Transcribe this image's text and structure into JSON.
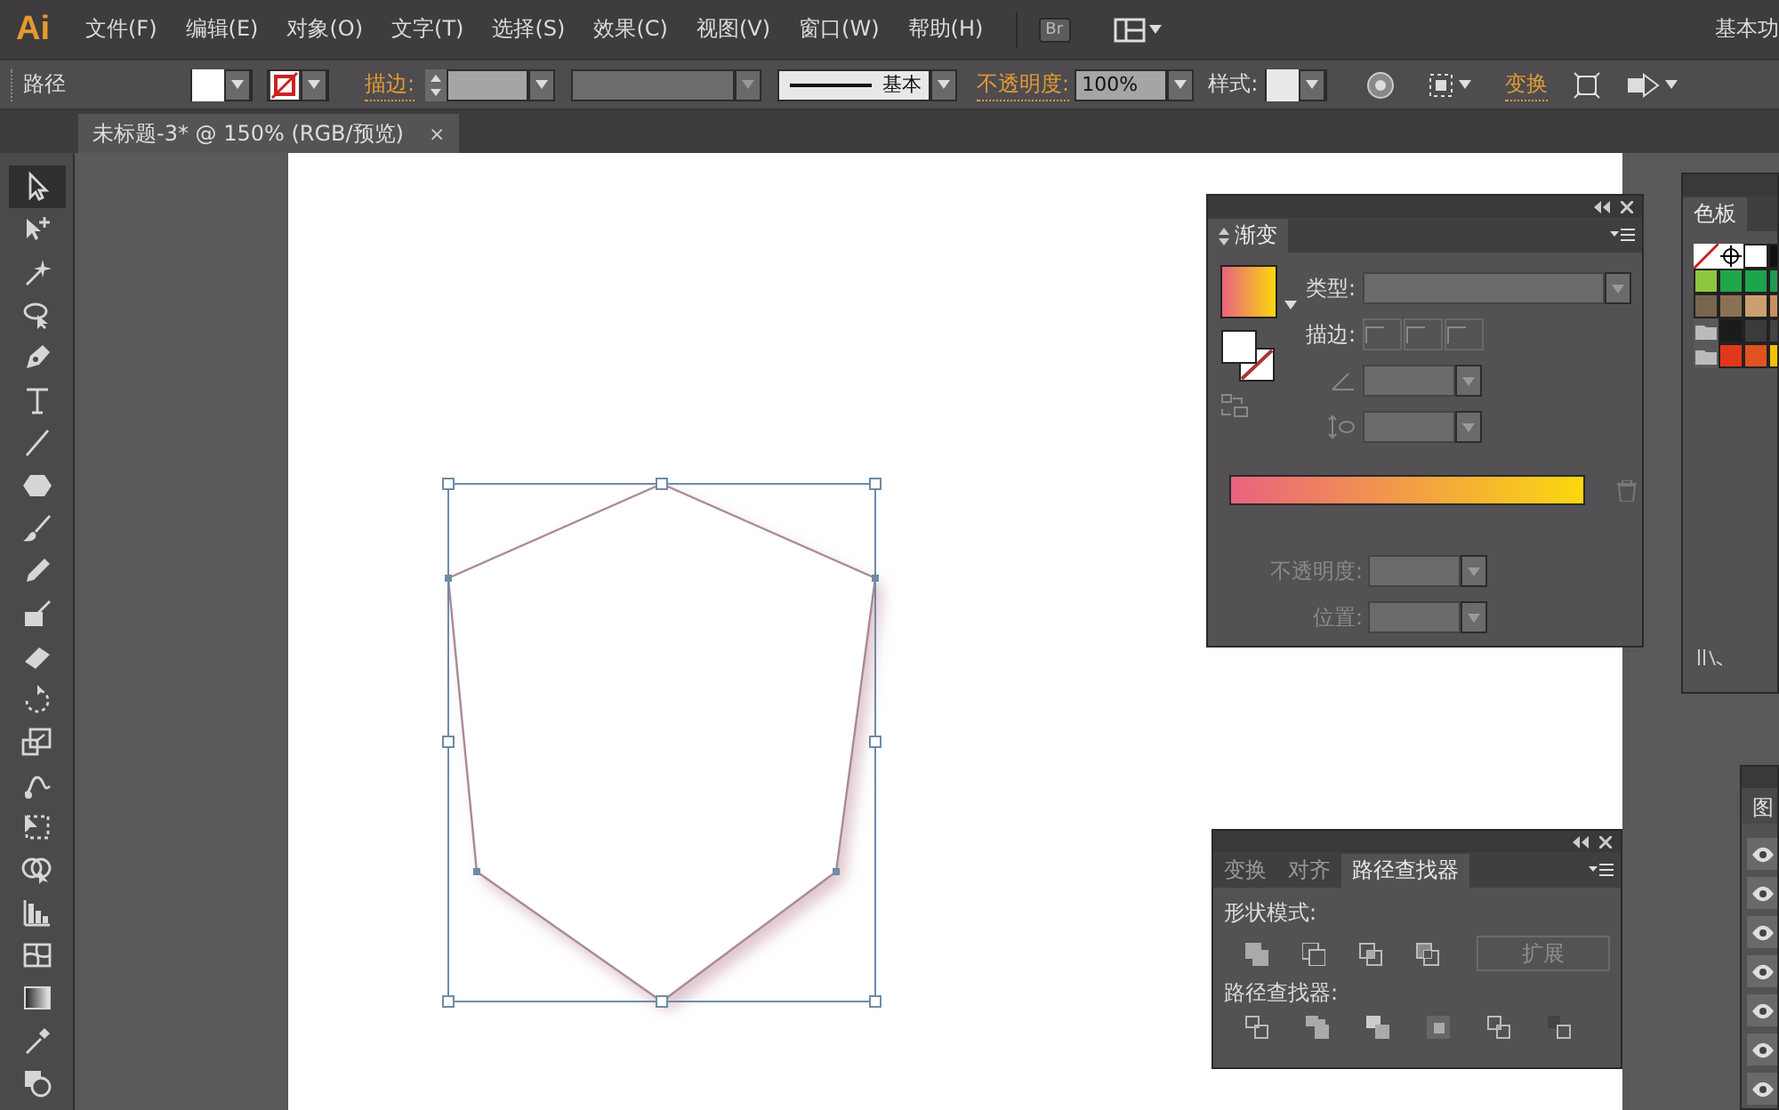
{
  "menu_bar": {
    "logo": "Ai",
    "menus": [
      "文件(F)",
      "编辑(E)",
      "对象(O)",
      "文字(T)",
      "选择(S)",
      "效果(C)",
      "视图(V)",
      "窗口(W)",
      "帮助(H)"
    ],
    "bridge_button": "Br",
    "workspace": "基本功"
  },
  "control_bar": {
    "selection": "路径",
    "stroke_label": "描边:",
    "line_style": "基本",
    "opacity_label": "不透明度:",
    "opacity": "100%",
    "style_label": "样式:",
    "transform_link": "变换"
  },
  "document_tab": {
    "title": "未标题-3* @ 150% (RGB/预览)",
    "close": "×"
  },
  "tools": [
    {
      "selected": true
    },
    {
      "selected": false
    },
    {
      "selected": false
    },
    {
      "selected": false
    },
    {
      "selected": false
    },
    {
      "selected": false
    },
    {
      "selected": false
    },
    {
      "selected": false
    },
    {
      "selected": false
    },
    {
      "selected": false
    },
    {
      "selected": false
    },
    {
      "selected": false
    },
    {
      "selected": false
    },
    {
      "selected": false
    },
    {
      "selected": false
    },
    {
      "selected": false
    },
    {
      "selected": false
    },
    {
      "selected": false
    },
    {
      "selected": false
    },
    {
      "selected": false
    },
    {
      "selected": false
    },
    {
      "selected": false
    }
  ],
  "gradient_panel": {
    "tab": "渐变",
    "type_label": "类型:",
    "stroke_label": "描边:",
    "opacity_label": "不透明度:",
    "location_label": "位置:",
    "stops": [
      {
        "color": "#e9637f"
      },
      {
        "color": "#fbd80f"
      }
    ]
  },
  "swatches_panel": {
    "tab": "色板",
    "swatches": [
      {
        "kind": "none"
      },
      {
        "kind": "registration"
      },
      {
        "kind": "color",
        "color": "#ffffff"
      },
      {
        "kind": "color",
        "color": "#111111"
      },
      {
        "kind": "color",
        "color": "#8dc63f"
      },
      {
        "kind": "color",
        "color": "#1fa84a"
      },
      {
        "kind": "color",
        "color": "#1ca54c"
      },
      {
        "kind": "color",
        "color": "#209a52"
      },
      {
        "kind": "color",
        "color": "#76664e"
      },
      {
        "kind": "color",
        "color": "#8a7154"
      },
      {
        "kind": "color",
        "color": "#c9a06e"
      },
      {
        "kind": "color",
        "color": "#c88f5c"
      },
      {
        "kind": "folder"
      },
      {
        "kind": "color",
        "color": "#1b1b1b"
      },
      {
        "kind": "color",
        "color": "#3b3b3b"
      },
      {
        "kind": "color",
        "color": "#444444"
      },
      {
        "kind": "folder"
      },
      {
        "kind": "color",
        "color": "#e0381a"
      },
      {
        "kind": "color",
        "color": "#e0521f"
      },
      {
        "kind": "color",
        "color": "#f6c000"
      }
    ]
  },
  "layers_panel": {
    "tab": "图",
    "rows": [
      {
        "visible": true
      },
      {
        "visible": true
      },
      {
        "visible": true
      },
      {
        "visible": true
      },
      {
        "visible": true
      },
      {
        "visible": true
      },
      {
        "visible": true
      }
    ]
  },
  "pathfinder_panel": {
    "tabs": [
      {
        "label": "变换",
        "selected": false
      },
      {
        "label": "对齐",
        "selected": false
      },
      {
        "label": "路径查找器",
        "selected": true
      }
    ],
    "shape_modes_label": "形状模式:",
    "expand_button": {
      "label": "扩展",
      "disabled": true
    },
    "pathfinders_label": "路径查找器:"
  }
}
